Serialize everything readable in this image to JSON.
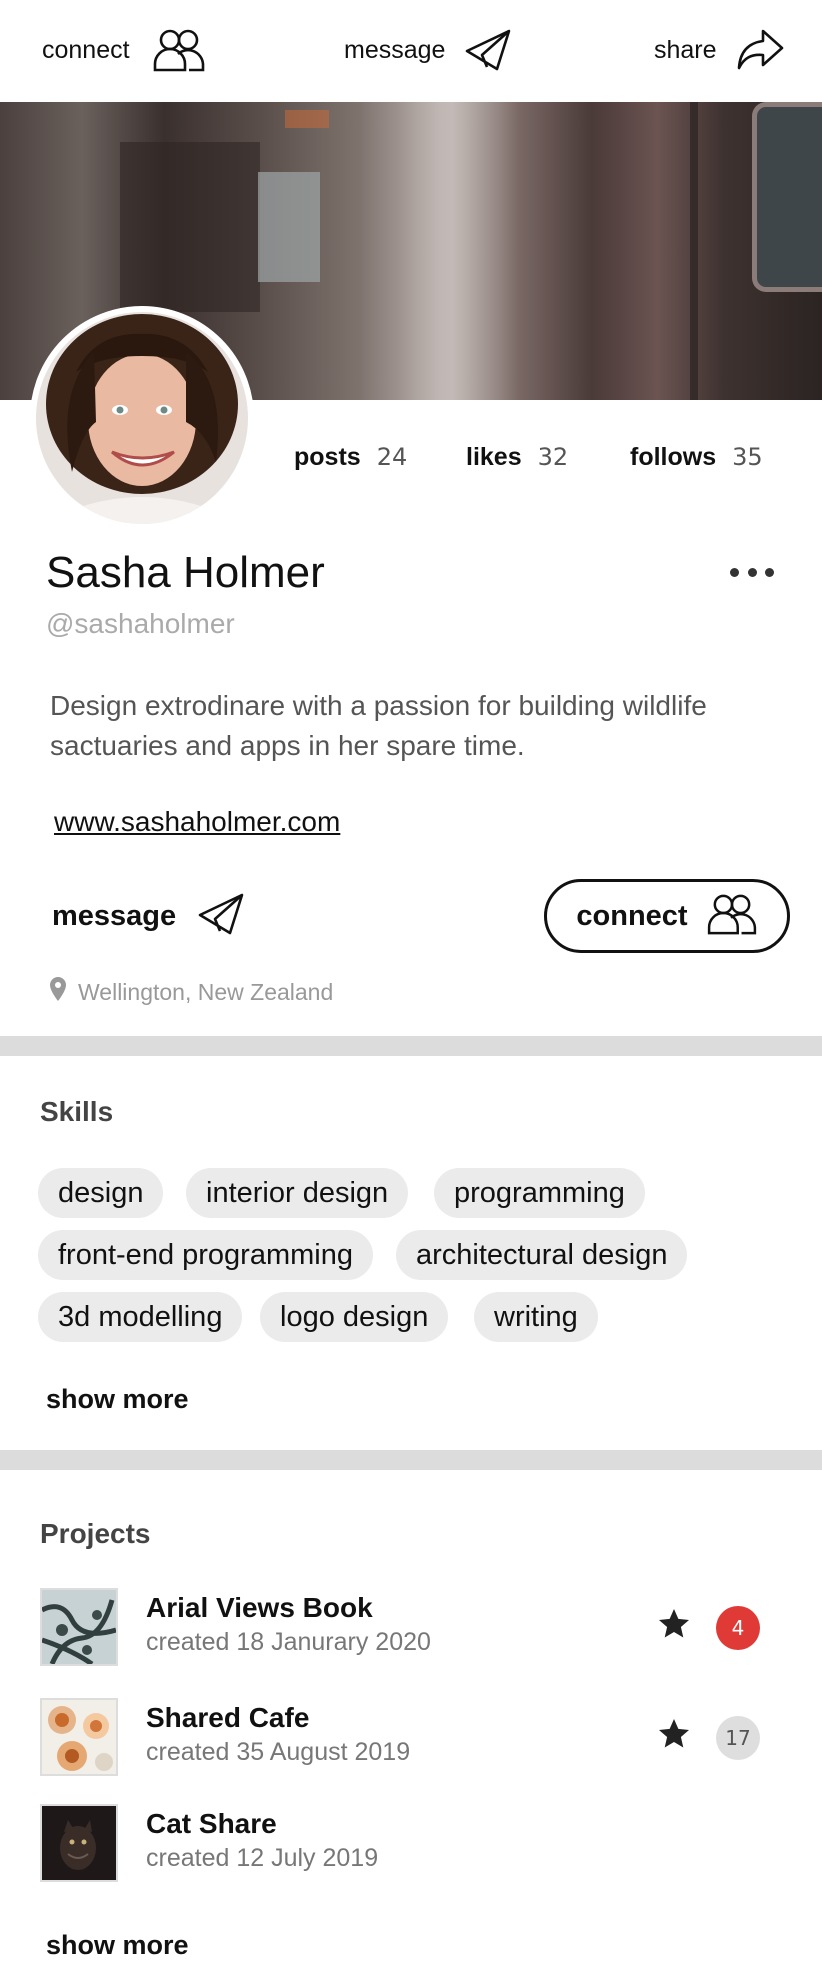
{
  "nav": {
    "connect_label": "connect",
    "message_label": "message",
    "share_label": "share"
  },
  "stats": [
    {
      "label": "posts",
      "value": "24"
    },
    {
      "label": "likes",
      "value": "32"
    },
    {
      "label": "follows",
      "value": "35"
    }
  ],
  "profile": {
    "name": "Sasha Holmer",
    "handle": "@sashaholmer",
    "bio": "Design extrodinare with a passion for building wildlife sactuaries and apps in her spare time.",
    "website": "www.sashaholmer.com",
    "message_label": "message",
    "connect_label": "connect",
    "location": "Wellington, New Zealand"
  },
  "skills": {
    "title": "Skills",
    "items": [
      "design",
      "interior design",
      "programming",
      "front-end programming",
      "architectural design",
      "3d modelling",
      "logo design",
      "writing"
    ],
    "show_more": "show more"
  },
  "projects": {
    "title": "Projects",
    "items": [
      {
        "title": "Arial Views Book",
        "date": "created 18 Janurary 2020",
        "badge": "4",
        "badge_color": "#e03a36",
        "starred": true
      },
      {
        "title": "Shared Cafe",
        "date": "created 35 August 2019",
        "badge": "17",
        "badge_color": "#dedede",
        "starred": true
      },
      {
        "title": "Cat Share",
        "date": "created 12 July 2019"
      }
    ],
    "show_more": "show more"
  },
  "colors": {
    "divider": "#dcdcdc",
    "chip_bg": "#ebebeb",
    "badge_red": "#e03a36",
    "badge_grey": "#dedede"
  }
}
